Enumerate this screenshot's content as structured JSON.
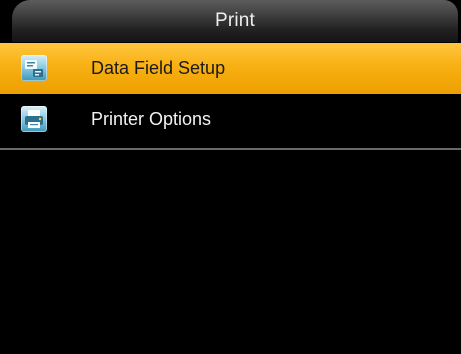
{
  "header": {
    "title": "Print"
  },
  "menu": {
    "items": [
      {
        "label": "Data Field Setup",
        "icon": "data-field-icon",
        "selected": true
      },
      {
        "label": "Printer Options",
        "icon": "printer-options-icon",
        "selected": false
      }
    ]
  },
  "colors": {
    "highlight": "#f8b012",
    "background": "#000000",
    "title_text": "#eeeeee"
  }
}
